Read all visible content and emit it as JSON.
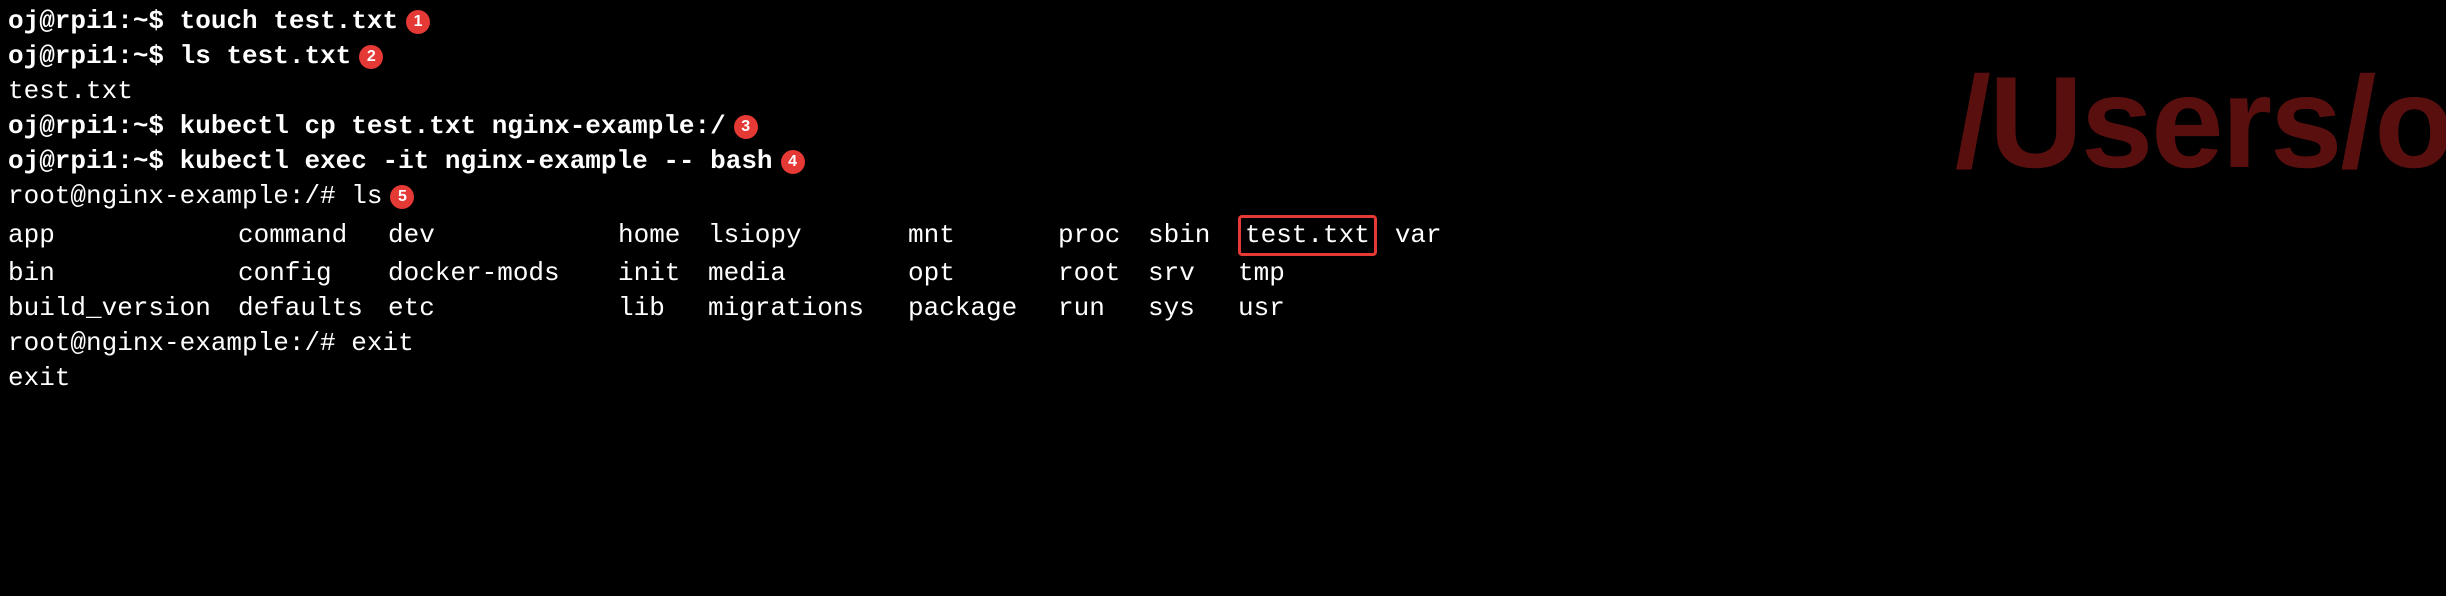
{
  "watermark": "/Users/oj",
  "lines": [
    {
      "type": "prompt",
      "prompt": "oj@rpi1:~$ ",
      "command": "touch test.txt",
      "bullet": "1"
    },
    {
      "type": "prompt",
      "prompt": "oj@rpi1:~$ ",
      "command": "ls test.txt",
      "bullet": "2"
    },
    {
      "type": "output",
      "text": "test.txt"
    },
    {
      "type": "prompt",
      "prompt": "oj@rpi1:~$ ",
      "command": "kubectl cp test.txt nginx-example:/",
      "bullet": "3"
    },
    {
      "type": "prompt",
      "prompt": "oj@rpi1:~$ ",
      "command": "kubectl exec -it nginx-example -- bash",
      "bullet": "4"
    },
    {
      "type": "root-prompt",
      "prompt": "root@nginx-example:/# ",
      "command": "ls",
      "bullet": "5"
    }
  ],
  "ls_columns": {
    "row1": {
      "c1": "app",
      "c2": "command",
      "c3": "dev",
      "c4": "home",
      "c5": "lsiopy",
      "c6": "mnt",
      "c7": "proc",
      "c8": "sbin",
      "c9": "test.txt",
      "c10": "var"
    },
    "row2": {
      "c1": "bin",
      "c2": "config",
      "c3": "docker-mods",
      "c4": "init",
      "c5": "media",
      "c6": "opt",
      "c7": "root",
      "c8": "srv",
      "c9": "tmp",
      "c10": ""
    },
    "row3": {
      "c1": "build_version",
      "c2": "defaults",
      "c3": "etc",
      "c4": "lib",
      "c5": "migrations",
      "c6": "package",
      "c7": "run",
      "c8": "sys",
      "c9": "usr",
      "c10": ""
    }
  },
  "exit_prompt": {
    "prompt": "root@nginx-example:/# ",
    "command": "exit"
  },
  "exit_output": "exit"
}
